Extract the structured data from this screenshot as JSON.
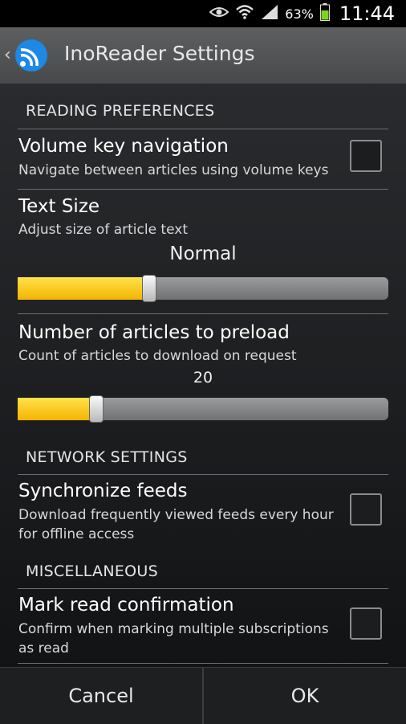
{
  "status_bar": {
    "battery_percent": "63%",
    "time": "11:44"
  },
  "action_bar": {
    "title": "InoReader Settings"
  },
  "sections": {
    "reading": {
      "header": "READING PREFERENCES",
      "volume": {
        "title": "Volume key navigation",
        "summary": "Navigate between articles using volume keys",
        "checked": false
      },
      "text_size": {
        "title": "Text Size",
        "summary": "Adjust size of article text",
        "value": "Normal",
        "level": 0.35
      },
      "preload": {
        "title": "Number of articles to preload",
        "summary": "Count of articles to download on request",
        "value": "20",
        "level": 0.2
      }
    },
    "network": {
      "header": "NETWORK SETTINGS",
      "sync": {
        "title": "Synchronize feeds",
        "summary": "Download frequently viewed feeds every hour for offline access",
        "checked": false
      }
    },
    "misc": {
      "header": "MISCELLANEOUS",
      "mark_read": {
        "title": "Mark read confirmation",
        "summary": "Confirm when marking multiple subscriptions as read",
        "checked": false
      }
    }
  },
  "buttons": {
    "cancel": "Cancel",
    "ok": "OK"
  },
  "colors": {
    "slider_fill": "#f4b400",
    "action_bar": "#55575a",
    "logo_blue": "#1e88e5"
  }
}
